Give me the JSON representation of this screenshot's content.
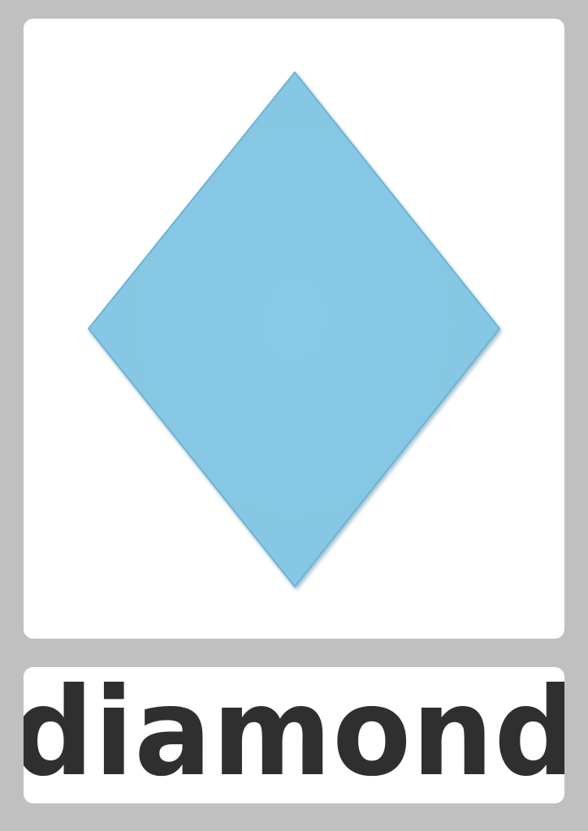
{
  "card": {
    "shape_icon": "diamond-shape",
    "shape_fill": "#87c9e6",
    "shape_edge": "#6fb3d2",
    "label": "diamond",
    "label_color": "#2f2f2f",
    "background_color": "#c0c0c0",
    "panel_color": "#ffffff"
  }
}
